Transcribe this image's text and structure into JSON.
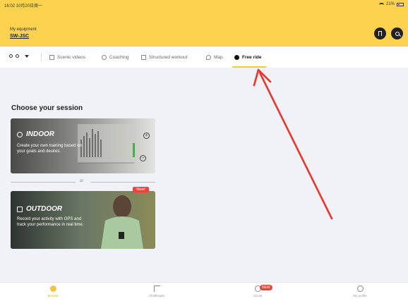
{
  "status_bar": {
    "time": "16:02 10月20日周一",
    "battery": "21%"
  },
  "header": {
    "equipment_label": "My equipment",
    "equipment_value": "SW-JSC"
  },
  "tabs": [
    {
      "label": "Scenic videos",
      "icon": "video-icon"
    },
    {
      "label": "Coaching",
      "icon": "coaching-icon"
    },
    {
      "label": "Structured workout",
      "icon": "chart-icon"
    },
    {
      "label": "Map",
      "icon": "map-icon"
    },
    {
      "label": "Free ride",
      "icon": "stopwatch-icon",
      "active": true
    }
  ],
  "main": {
    "section_title": "Choose your session",
    "indoor": {
      "title": "INDOOR",
      "description": "Create your own training based on your goals and desires."
    },
    "or_label": "or",
    "outdoor": {
      "title": "OUTDOOR",
      "badge": "New!",
      "description": "Record your activity with GPS and track your performance in real time."
    }
  },
  "bottom_nav": {
    "items": [
      {
        "label": "Browse",
        "icon": "browse-icon",
        "active": true
      },
      {
        "label": "Challenges",
        "icon": "flag-icon"
      },
      {
        "label": "Social",
        "icon": "social-icon",
        "badge": "NEW"
      },
      {
        "label": "My profile",
        "icon": "profile-icon"
      }
    ]
  },
  "colors": {
    "accent": "#fdd24f",
    "annotation_arrow": "#e8362b",
    "badge": "#e8453c"
  }
}
